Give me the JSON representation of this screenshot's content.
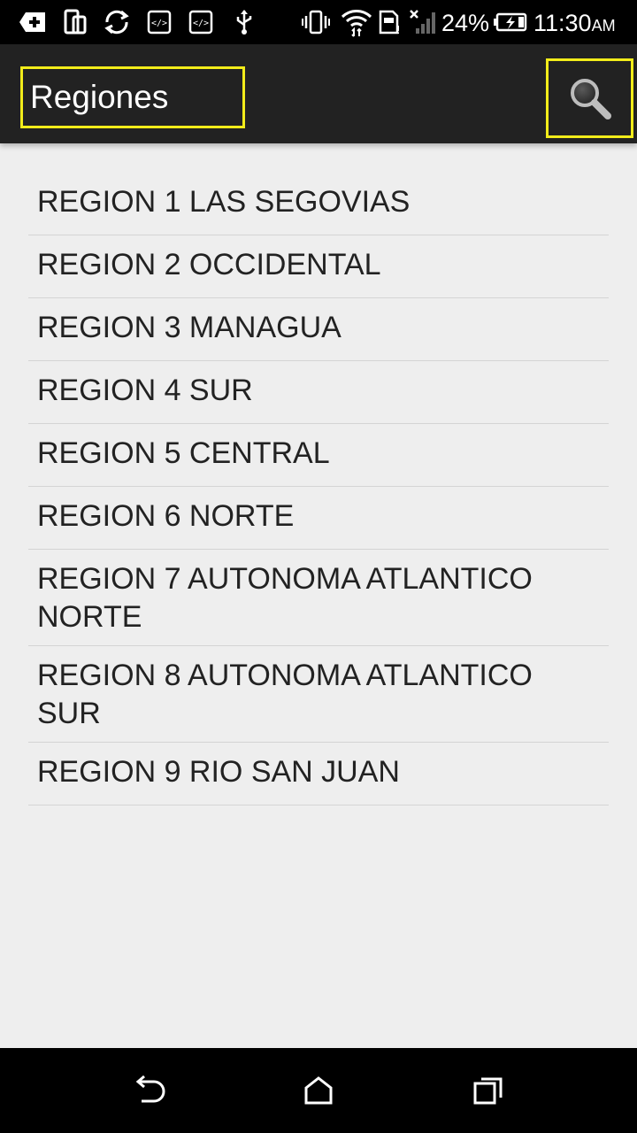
{
  "status_bar": {
    "battery_percent": "24%",
    "time": "11:30",
    "ampm": "AM",
    "icons": [
      "add-icon",
      "device-rotate-icon",
      "sync-icon",
      "code-icon",
      "code-icon",
      "usb-icon",
      "vibrate-icon",
      "wifi-icon",
      "sim-icon",
      "no-signal-icon",
      "battery-charging-icon"
    ]
  },
  "action_bar": {
    "title": "Regiones",
    "search_icon": "search-icon",
    "highlight_color": "#f2ec1a"
  },
  "regions": {
    "items": [
      {
        "label": "REGION 1 LAS SEGOVIAS"
      },
      {
        "label": "REGION 2 OCCIDENTAL"
      },
      {
        "label": "REGION 3 MANAGUA"
      },
      {
        "label": "REGION 4 SUR"
      },
      {
        "label": "REGION 5 CENTRAL"
      },
      {
        "label": "REGION 6 NORTE"
      },
      {
        "label": "REGION 7 AUTONOMA ATLANTICO NORTE"
      },
      {
        "label": "REGION 8 AUTONOMA ATLANTICO SUR"
      },
      {
        "label": "REGION 9 RIO SAN JUAN"
      }
    ]
  },
  "nav_bar": {
    "icons": [
      "back-icon",
      "home-icon",
      "recent-apps-icon"
    ]
  }
}
